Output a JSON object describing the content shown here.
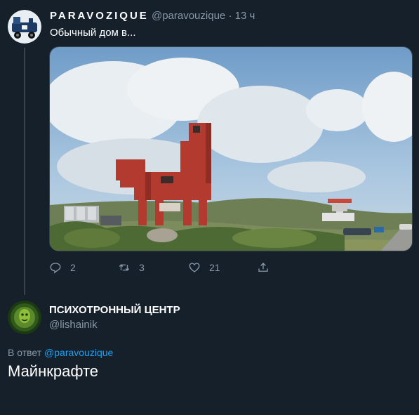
{
  "tweet": {
    "author_name": "PARAVOZIQUE",
    "author_handle": "@paravouzique",
    "separator": "·",
    "time": "13 ч",
    "text": "Обычный дом в...",
    "photo_icon": "photo-red-horse-building",
    "actions": {
      "reply_count": "2",
      "retweet_count": "3",
      "like_count": "21"
    }
  },
  "reply": {
    "author_name": "ПСИХОТРОННЫЙ ЦЕНТР",
    "author_handle": "@lishainik",
    "reply_prefix": "В ответ",
    "reply_to_handle": "@paravouzique",
    "text": "Майнкрафте"
  },
  "colors": {
    "background": "#15202b",
    "muted": "#8899a6",
    "link": "#1da1f2",
    "divider": "#38444d"
  }
}
